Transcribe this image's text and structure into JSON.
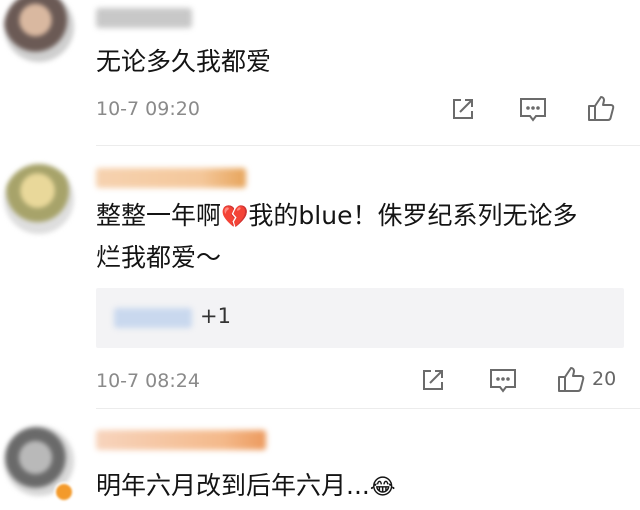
{
  "comments": [
    {
      "text": "无论多久我都爱",
      "time": "10-7 09:20",
      "likes": ""
    },
    {
      "text_line1_a": "整整一年啊",
      "emoji": "💔",
      "text_line1_b": "我的blue！侏罗纪系列无论多",
      "text_line2": "烂我都爱～",
      "reply_text": "+1",
      "time": "10-7 08:24",
      "likes": "20"
    },
    {
      "text": "明年六月改到后年六月...",
      "emoji": "😂"
    }
  ],
  "icons": {
    "share": "share-icon",
    "comment": "comment-icon",
    "like": "thumbs-up-icon",
    "broken_heart": "broken-heart-emoji",
    "laugh_cry": "laugh-cry-emoji"
  },
  "colors": {
    "icon_gray": "#6b6b6b",
    "meta_gray": "#8a8a8a",
    "reply_bg": "#f3f3f5",
    "blur_name_1": "#c8c8c8",
    "blur_name_2": "#f4c79a",
    "blur_name_3": "#f4b98a",
    "blur_reply": "#c9d8ee"
  }
}
